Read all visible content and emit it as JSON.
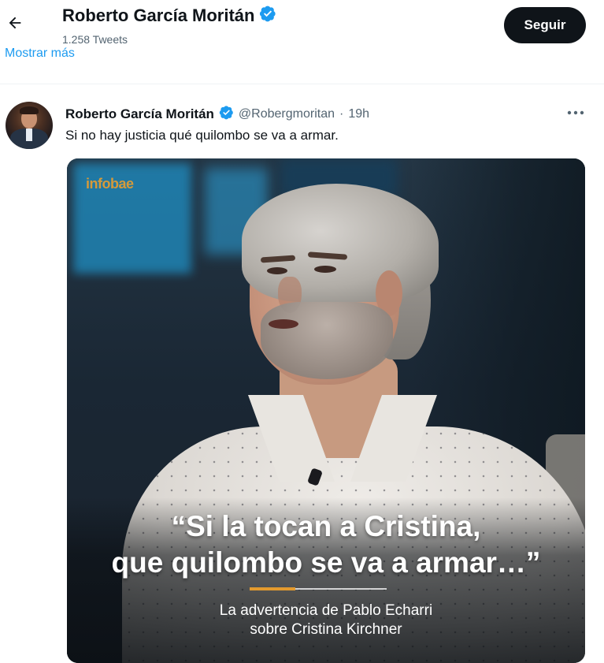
{
  "header": {
    "name": "Roberto García Moritán",
    "tweet_count": "1.258 Tweets",
    "show_more": "Mostrar más",
    "follow_label": "Seguir"
  },
  "tweet": {
    "author": "Roberto García Moritán",
    "handle": "@Robergmoritan",
    "separator": "·",
    "time": "19h",
    "text": "Si no hay justicia qué quilombo se va a armar."
  },
  "media": {
    "brand": "infobae",
    "quote_line1": "“Si la tocan a Cristina,",
    "quote_line2": "que quilombo se va a armar…”",
    "caption_line1": "La advertencia de Pablo Echarri",
    "caption_line2": "sobre Cristina Kirchner"
  },
  "icons": {
    "back": "arrow-left-icon",
    "verified": "verified-badge-icon",
    "more": "more-horizontal-icon"
  },
  "colors": {
    "accent": "#1d9bf0",
    "follow_bg": "#0f1419",
    "secondary_text": "#536471",
    "brand": "#d59a3a",
    "divider_orange": "#e39a2e"
  }
}
